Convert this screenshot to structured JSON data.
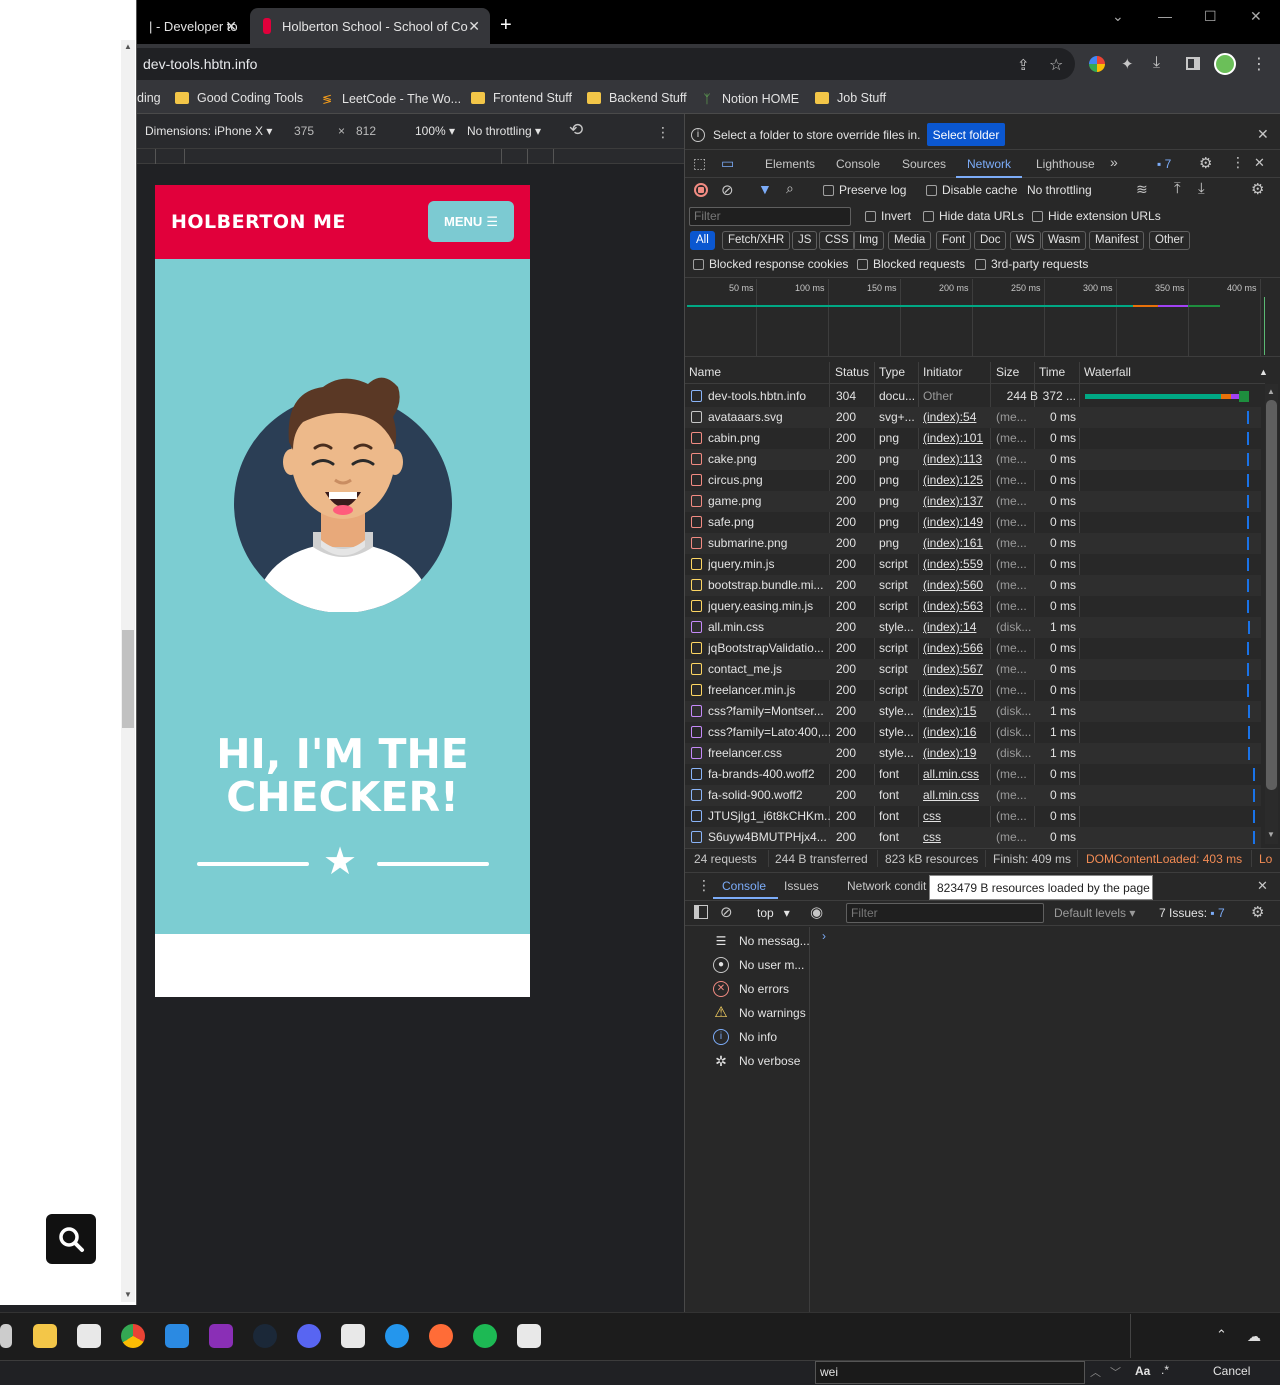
{
  "browser": {
    "tabs": [
      {
        "title": "| - Developer to"
      },
      {
        "title": "Holberton School - School of Co"
      }
    ],
    "url": "dev-tools.hbtn.info",
    "bookmarks": [
      "ding",
      "Good Coding Tools",
      "LeetCode - The Wo...",
      "Frontend Stuff",
      "Backend Stuff",
      "Notion HOME",
      "Job Stuff"
    ]
  },
  "device_toolbar": {
    "dimensions": "Dimensions: iPhone X",
    "width": "375",
    "x": "×",
    "height": "812",
    "zoom": "100%",
    "throttle": "No throttling"
  },
  "mobile_page": {
    "brand": "HOLBERTON ME",
    "menu": "MENU",
    "title_line1": "HI, I'M THE",
    "title_line2": "CHECKER!"
  },
  "devtools": {
    "info_text": "Select a folder to store override files in.",
    "select_folder": "Select folder",
    "tabs": [
      "Elements",
      "Console",
      "Sources",
      "Network",
      "Lighthouse"
    ],
    "issues_count": "7",
    "preserve_log": "Preserve log",
    "disable_cache": "Disable cache",
    "throttle": "No throttling",
    "filter_placeholder": "Filter",
    "invert": "Invert",
    "hide_data": "Hide data URLs",
    "hide_ext": "Hide extension URLs",
    "types": [
      "All",
      "Fetch/XHR",
      "JS",
      "CSS",
      "Img",
      "Media",
      "Font",
      "Doc",
      "WS",
      "Wasm",
      "Manifest",
      "Other"
    ],
    "blocked_cookies": "Blocked response cookies",
    "blocked_requests": "Blocked requests",
    "third_party": "3rd-party requests",
    "timeline_ticks": [
      "50 ms",
      "100 ms",
      "150 ms",
      "200 ms",
      "250 ms",
      "300 ms",
      "350 ms",
      "400 ms"
    ],
    "columns": [
      "Name",
      "Status",
      "Type",
      "Initiator",
      "Size",
      "Time",
      "Waterfall"
    ],
    "rows": [
      {
        "name": "dev-tools.hbtn.info",
        "status": "304",
        "type": "docu...",
        "initiator": "Other",
        "size": "244 B",
        "time": "372 ..."
      },
      {
        "name": "avataaars.svg",
        "status": "200",
        "type": "svg+...",
        "initiator": "(index):54",
        "size": "(me...",
        "time": "0 ms"
      },
      {
        "name": "cabin.png",
        "status": "200",
        "type": "png",
        "initiator": "(index):101",
        "size": "(me...",
        "time": "0 ms"
      },
      {
        "name": "cake.png",
        "status": "200",
        "type": "png",
        "initiator": "(index):113",
        "size": "(me...",
        "time": "0 ms"
      },
      {
        "name": "circus.png",
        "status": "200",
        "type": "png",
        "initiator": "(index):125",
        "size": "(me...",
        "time": "0 ms"
      },
      {
        "name": "game.png",
        "status": "200",
        "type": "png",
        "initiator": "(index):137",
        "size": "(me...",
        "time": "0 ms"
      },
      {
        "name": "safe.png",
        "status": "200",
        "type": "png",
        "initiator": "(index):149",
        "size": "(me...",
        "time": "0 ms"
      },
      {
        "name": "submarine.png",
        "status": "200",
        "type": "png",
        "initiator": "(index):161",
        "size": "(me...",
        "time": "0 ms"
      },
      {
        "name": "jquery.min.js",
        "status": "200",
        "type": "script",
        "initiator": "(index):559",
        "size": "(me...",
        "time": "0 ms"
      },
      {
        "name": "bootstrap.bundle.mi...",
        "status": "200",
        "type": "script",
        "initiator": "(index):560",
        "size": "(me...",
        "time": "0 ms"
      },
      {
        "name": "jquery.easing.min.js",
        "status": "200",
        "type": "script",
        "initiator": "(index):563",
        "size": "(me...",
        "time": "0 ms"
      },
      {
        "name": "all.min.css",
        "status": "200",
        "type": "style...",
        "initiator": "(index):14",
        "size": "(disk...",
        "time": "1 ms"
      },
      {
        "name": "jqBootstrapValidatio...",
        "status": "200",
        "type": "script",
        "initiator": "(index):566",
        "size": "(me...",
        "time": "0 ms"
      },
      {
        "name": "contact_me.js",
        "status": "200",
        "type": "script",
        "initiator": "(index):567",
        "size": "(me...",
        "time": "0 ms"
      },
      {
        "name": "freelancer.min.js",
        "status": "200",
        "type": "script",
        "initiator": "(index):570",
        "size": "(me...",
        "time": "0 ms"
      },
      {
        "name": "css?family=Montser...",
        "status": "200",
        "type": "style...",
        "initiator": "(index):15",
        "size": "(disk...",
        "time": "1 ms"
      },
      {
        "name": "css?family=Lato:400,...",
        "status": "200",
        "type": "style...",
        "initiator": "(index):16",
        "size": "(disk...",
        "time": "1 ms"
      },
      {
        "name": "freelancer.css",
        "status": "200",
        "type": "style...",
        "initiator": "(index):19",
        "size": "(disk...",
        "time": "1 ms"
      },
      {
        "name": "fa-brands-400.woff2",
        "status": "200",
        "type": "font",
        "initiator": "all.min.css",
        "size": "(me...",
        "time": "0 ms"
      },
      {
        "name": "fa-solid-900.woff2",
        "status": "200",
        "type": "font",
        "initiator": "all.min.css",
        "size": "(me...",
        "time": "0 ms"
      },
      {
        "name": "JTUSjlg1_i6t8kCHKm...",
        "status": "200",
        "type": "font",
        "initiator": "css",
        "size": "(me...",
        "time": "0 ms"
      },
      {
        "name": "S6uyw4BMUTPHjx4...",
        "status": "200",
        "type": "font",
        "initiator": "css",
        "size": "(me...",
        "time": "0 ms"
      }
    ],
    "status": {
      "requests": "24 requests",
      "transferred": "244 B transferred",
      "resources": "823 kB resources",
      "finish": "Finish: 409 ms",
      "dcl": "DOMContentLoaded: 403 ms",
      "load": "Lo"
    },
    "drawer_tabs": [
      "Console",
      "Issues",
      "Network condit"
    ],
    "tooltip": "823479 B resources loaded by the page",
    "context": "top",
    "console_filter": "Filter",
    "default_levels": "Default levels",
    "issues": "7 Issues:",
    "issues_num": "7",
    "messages": [
      "No messag...",
      "No user m...",
      "No errors",
      "No warnings",
      "No info",
      "No verbose"
    ]
  },
  "findbar": {
    "query": "wei",
    "aa": "Aa",
    "regex": ".*",
    "cancel": "Cancel"
  }
}
